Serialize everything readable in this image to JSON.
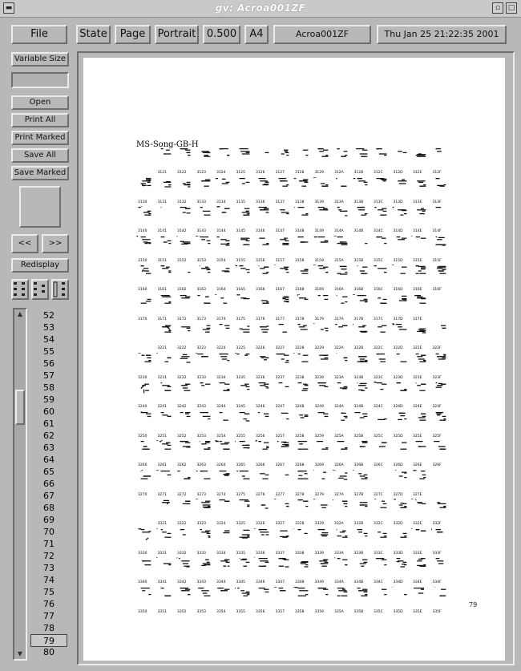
{
  "window": {
    "title": "gv: Acroa001ZF"
  },
  "menubar": {
    "file": "File",
    "state": "State",
    "page": "Page",
    "orientation": "Portrait",
    "scale": "0.500",
    "media": "A4",
    "filename": "Acroa001ZF",
    "date": "Thu Jan 25 21:22:35 2001"
  },
  "sidebar": {
    "variable_size": "Variable Size",
    "open": "Open",
    "print_all": "Print All",
    "print_marked": "Print Marked",
    "save_all": "Save All",
    "save_marked": "Save Marked",
    "prev": "<<",
    "next": ">>",
    "redisplay": "Redisplay"
  },
  "pages_list": {
    "items": [
      "52",
      "53",
      "54",
      "55",
      "56",
      "57",
      "58",
      "59",
      "60",
      "61",
      "62",
      "63",
      "64",
      "65",
      "66",
      "67",
      "68",
      "69",
      "70",
      "71",
      "72",
      "73",
      "74",
      "75",
      "76",
      "77",
      "78",
      "79",
      "80"
    ],
    "selected": "79"
  },
  "document": {
    "title": "MS-Song-GB-H",
    "page_number": "79",
    "rows": [
      {
        "hanzi": "薄雹保堡饱宝抱报暴豹鲍爆杯碑悲",
        "codes": [
          "3121",
          "3122",
          "3123",
          "3124",
          "3125",
          "3126",
          "3127",
          "3128",
          "3129",
          "312A",
          "312B",
          "312C",
          "312D",
          "312E",
          "312F"
        ],
        "start": 1
      },
      {
        "hanzi": "卑北辈背贝钡倍狈备惫焙被奔苯本笨",
        "codes": [
          "3130",
          "3131",
          "3132",
          "3133",
          "3134",
          "3135",
          "3136",
          "3137",
          "3138",
          "3139",
          "313A",
          "313B",
          "313C",
          "313D",
          "313E",
          "313F"
        ],
        "start": 0
      },
      {
        "hanzi": "崩绷甭泵蹦迸逼鼻比鄙笔彼碧蓖蔽毕",
        "codes": [
          "3140",
          "3141",
          "3142",
          "3143",
          "3144",
          "3145",
          "3146",
          "3147",
          "3148",
          "3149",
          "314A",
          "314B",
          "314C",
          "314D",
          "314E",
          "314F"
        ],
        "start": 0
      },
      {
        "hanzi": "毙毖币庇痹闭敝弊必辟壁臂避陛鞭边",
        "codes": [
          "3150",
          "3151",
          "3152",
          "3153",
          "3154",
          "3155",
          "3156",
          "3157",
          "3158",
          "3159",
          "315A",
          "315B",
          "315C",
          "315D",
          "315E",
          "315F"
        ],
        "start": 0
      },
      {
        "hanzi": "编贬扁便变卞辨辩辫遍标彪膘表鳖憋",
        "codes": [
          "3160",
          "3161",
          "3162",
          "3163",
          "3164",
          "3165",
          "3166",
          "3167",
          "3168",
          "3169",
          "316A",
          "316B",
          "316C",
          "316D",
          "316E",
          "316F"
        ],
        "start": 0
      },
      {
        "hanzi": "别瘪彬斌濒滨宾摈兵冰柄丙秉饼炳",
        "codes": [
          "3170",
          "3171",
          "3172",
          "3173",
          "3174",
          "3175",
          "3176",
          "3177",
          "3178",
          "3179",
          "317A",
          "317B",
          "317C",
          "317D",
          "317E"
        ],
        "start": 0
      },
      {
        "hanzi": "病并玻菠播拨钵波博勃搏铂箔伯帛",
        "codes": [
          "3221",
          "3222",
          "3223",
          "3224",
          "3225",
          "3226",
          "3227",
          "3228",
          "3229",
          "322A",
          "322B",
          "322C",
          "322D",
          "322E",
          "322F"
        ],
        "start": 1
      },
      {
        "hanzi": "舶脖膊渤泊驳捕卜哺补埠不布步簿部",
        "codes": [
          "3230",
          "3231",
          "3232",
          "3233",
          "3234",
          "3235",
          "3236",
          "3237",
          "3238",
          "3239",
          "323A",
          "323B",
          "323C",
          "323D",
          "323E",
          "323F"
        ],
        "start": 0
      },
      {
        "hanzi": "怖擦猜裁材才财睬踩采彩菜蔡餐参蚕",
        "codes": [
          "3240",
          "3241",
          "3242",
          "3243",
          "3244",
          "3245",
          "3246",
          "3247",
          "3248",
          "3249",
          "324A",
          "324B",
          "324C",
          "324D",
          "324E",
          "324F"
        ],
        "start": 0
      },
      {
        "hanzi": "残惭惨灿苍舱仓沧藏操糙槽曹草厕策",
        "codes": [
          "3250",
          "3251",
          "3252",
          "3253",
          "3254",
          "3255",
          "3256",
          "3257",
          "3258",
          "3259",
          "325A",
          "325B",
          "325C",
          "325D",
          "325E",
          "325F"
        ],
        "start": 0
      },
      {
        "hanzi": "侧册测层蹭插叉茬茶查碴搽察岔差诧",
        "codes": [
          "3260",
          "3261",
          "3262",
          "3263",
          "3264",
          "3265",
          "3266",
          "3267",
          "3268",
          "3269",
          "326A",
          "326B",
          "326C",
          "326D",
          "326E",
          "326F"
        ],
        "start": 0
      },
      {
        "hanzi": "拆柴豺搀掺蝉馋谗缠铲产阐颤昌猖",
        "codes": [
          "3270",
          "3271",
          "3272",
          "3273",
          "3274",
          "3275",
          "3276",
          "3277",
          "3278",
          "3279",
          "327A",
          "327B",
          "327C",
          "327D",
          "327E"
        ],
        "start": 0
      },
      {
        "hanzi": "场尝常长偿肠厂敞畅唱倡超抄钞朝",
        "codes": [
          "3321",
          "3322",
          "3323",
          "3324",
          "3325",
          "3326",
          "3327",
          "3328",
          "3329",
          "332A",
          "332B",
          "332C",
          "332D",
          "332E",
          "332F"
        ],
        "start": 1
      },
      {
        "hanzi": "嘲潮巢吵炒车扯撤掣彻澈郴臣辰尘晨",
        "codes": [
          "3330",
          "3331",
          "3332",
          "3333",
          "3334",
          "3335",
          "3336",
          "3337",
          "3338",
          "3339",
          "333A",
          "333B",
          "333C",
          "333D",
          "333E",
          "333F"
        ],
        "start": 0
      },
      {
        "hanzi": "忱沉陈趁衬撑称城橙成呈乘程惩澄诚",
        "codes": [
          "3340",
          "3341",
          "3342",
          "3343",
          "3344",
          "3345",
          "3346",
          "3347",
          "3348",
          "3349",
          "334A",
          "334B",
          "334C",
          "334D",
          "334E",
          "334F"
        ],
        "start": 0
      },
      {
        "hanzi": "承逞骋秤吃痴持匙池迟弛驰耻齿侈尺",
        "codes": [
          "3350",
          "3351",
          "3352",
          "3353",
          "3354",
          "3355",
          "3356",
          "3357",
          "3358",
          "3359",
          "335A",
          "335B",
          "335C",
          "335D",
          "335E",
          "335F"
        ],
        "start": 0
      }
    ]
  }
}
